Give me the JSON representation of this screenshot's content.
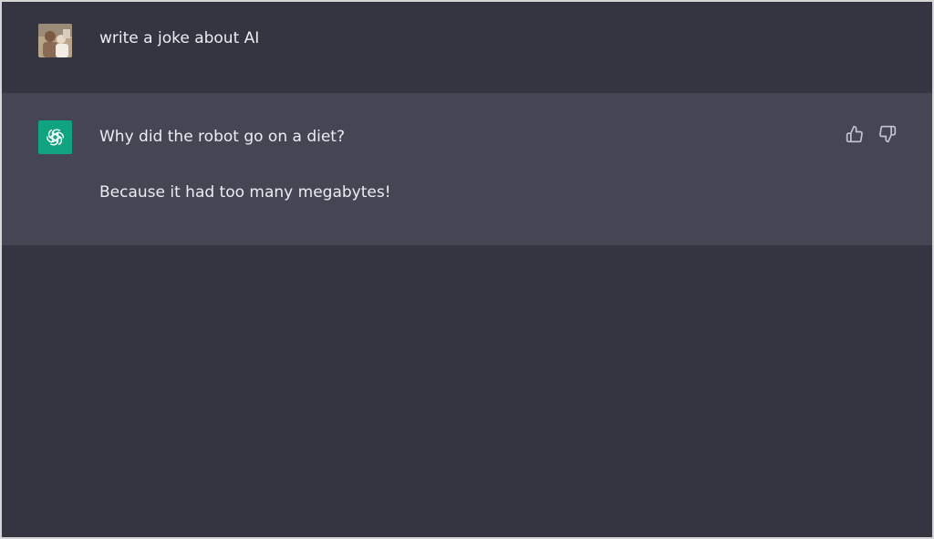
{
  "conversation": {
    "user_message": {
      "text": "write a joke about AI",
      "avatar_icon": "user-photo-avatar"
    },
    "assistant_message": {
      "lines": [
        "Why did the robot go on a diet?",
        "Because it had too many megabytes!"
      ],
      "avatar_icon": "openai-logo-icon",
      "feedback": {
        "like_icon": "thumbs-up-icon",
        "dislike_icon": "thumbs-down-icon"
      }
    }
  },
  "colors": {
    "page_background": "#343541",
    "assistant_background": "#444654",
    "text": "#ececf1",
    "bot_avatar": "#10a37f",
    "icon": "#c5c5d2"
  }
}
